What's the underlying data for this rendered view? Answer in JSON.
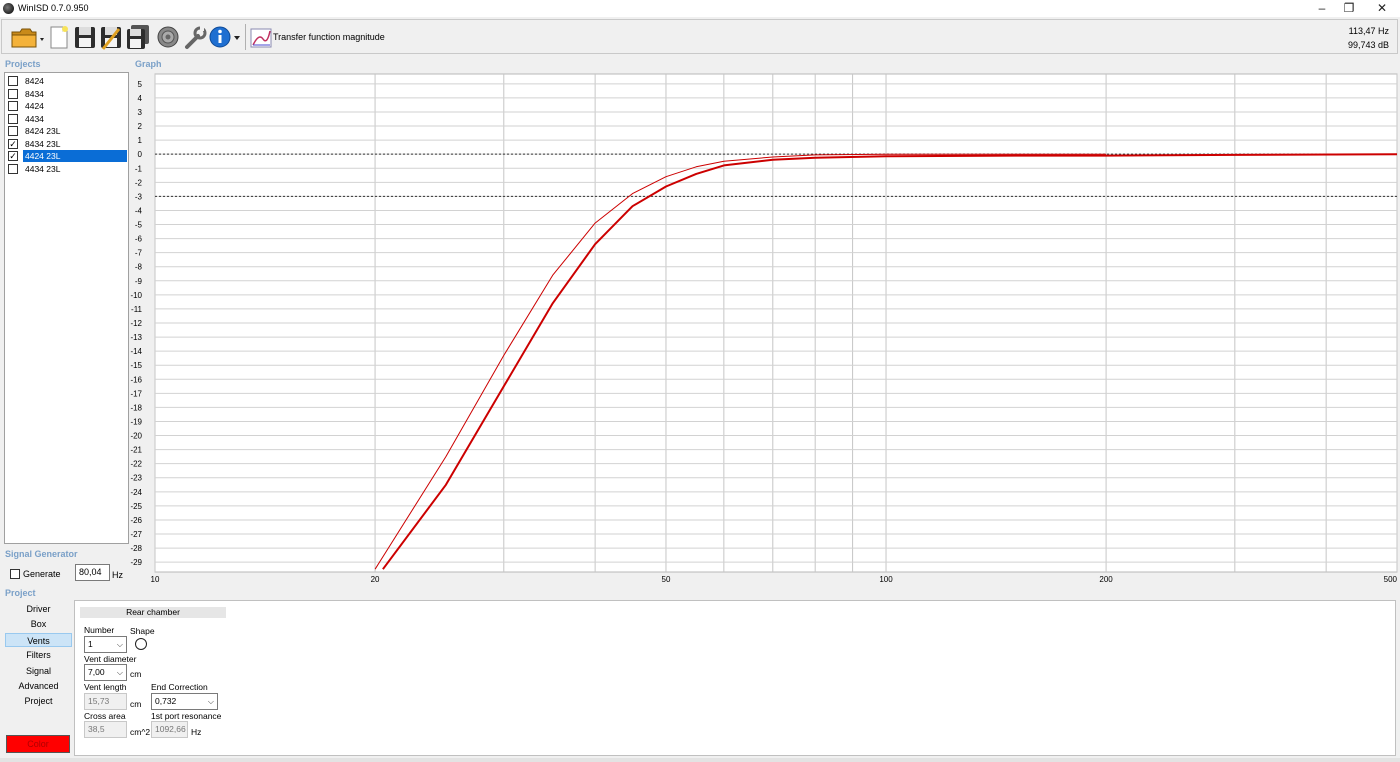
{
  "window": {
    "title": "WinISD 0.7.0.950",
    "minimize": "–",
    "restore": "❐",
    "close": "✕"
  },
  "toolbar": {
    "icons": [
      "open-folder-icon",
      "new-project-icon",
      "save-icon",
      "save-as-icon",
      "save-all-icon",
      "driver-editor-icon",
      "tools-icon",
      "info-icon"
    ],
    "graph_type_label": "Transfer function magnitude",
    "readout_freq": "113,47 Hz",
    "readout_db": "99,743 dB"
  },
  "projects": {
    "label": "Projects",
    "items": [
      {
        "name": "8424",
        "checked": false,
        "selected": false
      },
      {
        "name": "8434",
        "checked": false,
        "selected": false
      },
      {
        "name": "4424",
        "checked": false,
        "selected": false
      },
      {
        "name": "4434",
        "checked": false,
        "selected": false
      },
      {
        "name": "8424 23L",
        "checked": false,
        "selected": false
      },
      {
        "name": "8434 23L",
        "checked": true,
        "selected": false
      },
      {
        "name": "4424 23L",
        "checked": true,
        "selected": true
      },
      {
        "name": "4434 23L",
        "checked": false,
        "selected": false
      }
    ]
  },
  "graph": {
    "label": "Graph",
    "chart_data": {
      "type": "line",
      "xscale": "log",
      "xlim": [
        10,
        500
      ],
      "ylim": [
        -29.7,
        5.7
      ],
      "x_ticks": [
        10,
        20,
        50,
        100,
        200,
        500
      ],
      "y_ticks": [
        5,
        4,
        3,
        2,
        1,
        0,
        -1,
        -2,
        -3,
        -4,
        -5,
        -6,
        -7,
        -8,
        -9,
        -10,
        -11,
        -12,
        -13,
        -14,
        -15,
        -16,
        -17,
        -18,
        -19,
        -20,
        -21,
        -22,
        -23,
        -24,
        -25,
        -26,
        -27,
        -28,
        -29
      ],
      "reference_lines_y": [
        0,
        -3
      ],
      "grid": true,
      "line_color": "#cc0000",
      "series": [
        {
          "line_width": 1,
          "x": [
            20,
            25,
            30,
            35,
            40,
            45,
            50,
            55,
            60,
            70,
            80,
            100,
            150,
            200
          ],
          "y": [
            -29.5,
            -21.5,
            -14.3,
            -8.6,
            -4.9,
            -2.8,
            -1.6,
            -0.9,
            -0.5,
            -0.2,
            -0.05,
            0,
            0,
            0
          ]
        },
        {
          "line_width": 2,
          "x": [
            20.5,
            25,
            30,
            35,
            40,
            45,
            50,
            55,
            60,
            70,
            80,
            100,
            150,
            200,
            300,
            500
          ],
          "y": [
            -29.5,
            -23.5,
            -16.5,
            -10.6,
            -6.4,
            -3.7,
            -2.3,
            -1.4,
            -0.8,
            -0.4,
            -0.25,
            -0.15,
            -0.1,
            -0.1,
            -0.05,
            0
          ]
        }
      ]
    }
  },
  "signal_generator": {
    "label": "Signal Generator",
    "generate_label": "Generate",
    "frequency": "80,04",
    "unit": "Hz"
  },
  "project_nav": {
    "label": "Project",
    "items": [
      "Driver",
      "Box",
      "Vents",
      "Filters",
      "Signal",
      "Advanced",
      "Project"
    ],
    "active": "Vents",
    "color_label": "Color",
    "color": "#ff0000"
  },
  "vents_panel": {
    "tab": "Rear chamber",
    "number_label": "Number",
    "number_value": "1",
    "shape_label": "Shape",
    "vent_diameter_label": "Vent diameter",
    "vent_diameter_value": "7,00",
    "vent_diameter_unit": "cm",
    "vent_length_label": "Vent length",
    "vent_length_value": "15,73",
    "vent_length_unit": "cm",
    "end_correction_label": "End Correction",
    "end_correction_value": "0,732",
    "cross_area_label": "Cross area",
    "cross_area_value": "38,5",
    "cross_area_unit": "cm^2",
    "port_resonance_label": "1st port resonance",
    "port_resonance_value": "1092,66",
    "port_resonance_unit": "Hz"
  }
}
